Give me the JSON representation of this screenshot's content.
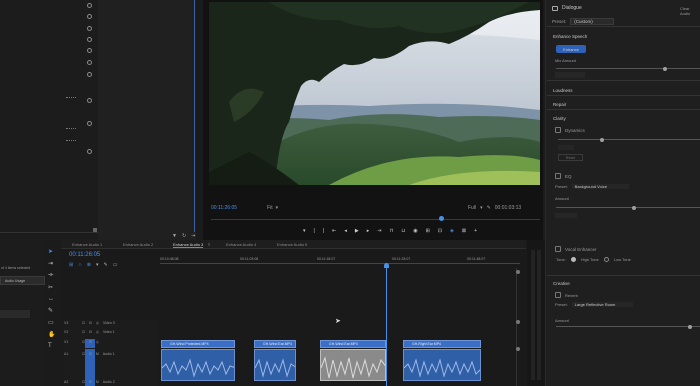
{
  "program": {
    "timecode": "00:11:26:05",
    "fit": "Fit",
    "quality": "Full",
    "duration": "00:01:03:13"
  },
  "timeline": {
    "tabs": [
      "Enhance Audio 1",
      "Enhance Audio 2",
      "Enhance Audio 3",
      "Enhance Audio 4",
      "Enhance Audio 5"
    ],
    "active_tab_index": 2,
    "timecode": "00:11:26:05",
    "ruler": [
      "00:10:48:08",
      "00:11:03:08",
      "00:11:18:07",
      "00:11:33:07",
      "00:11:48:07"
    ],
    "tracks": {
      "v3": "V3",
      "v2": "V2",
      "v1": "V1",
      "a1": "A1",
      "a2": "A2",
      "video3": "Video 3",
      "video1": "Video 1",
      "audio1": "Audio 1",
      "audio2": "Audio 2"
    },
    "clips": [
      "GH-Wind Protected.MP4",
      "GH-Wind Ear.MP4",
      "GH-Wind Ear.MP4",
      "GH-Right Ear.MP4"
    ]
  },
  "left": {
    "items_selected": "of 4 items selected",
    "audio_usage": "Audio Usage"
  },
  "essential": {
    "title": "Dialogue",
    "clear_audio": "Clear Audio",
    "preset_label": "Preset:",
    "preset_value": "(Custom)",
    "enhance_speech": "Enhance Speech",
    "enhance_btn": "Enhance",
    "mix_amount": "Mix Amount",
    "loudness": "Loudness",
    "repair": "Repair",
    "clarity": "Clarity",
    "dynamics": "Dynamics",
    "reset": "Reset",
    "eq": "EQ",
    "eq_preset_label": "Preset:",
    "eq_preset_value": "Background Voice",
    "amount": "Amount",
    "vocal_enhancer": "Vocal Enhancer",
    "tone": "Tone:",
    "high_tone": "High Tone",
    "low_tone": "Low Tone",
    "creative": "Creative",
    "reverb": "Reverb",
    "reverb_preset_label": "Preset:",
    "reverb_preset_value": "Large Reflective Room",
    "reverb_amount": "Amount"
  }
}
